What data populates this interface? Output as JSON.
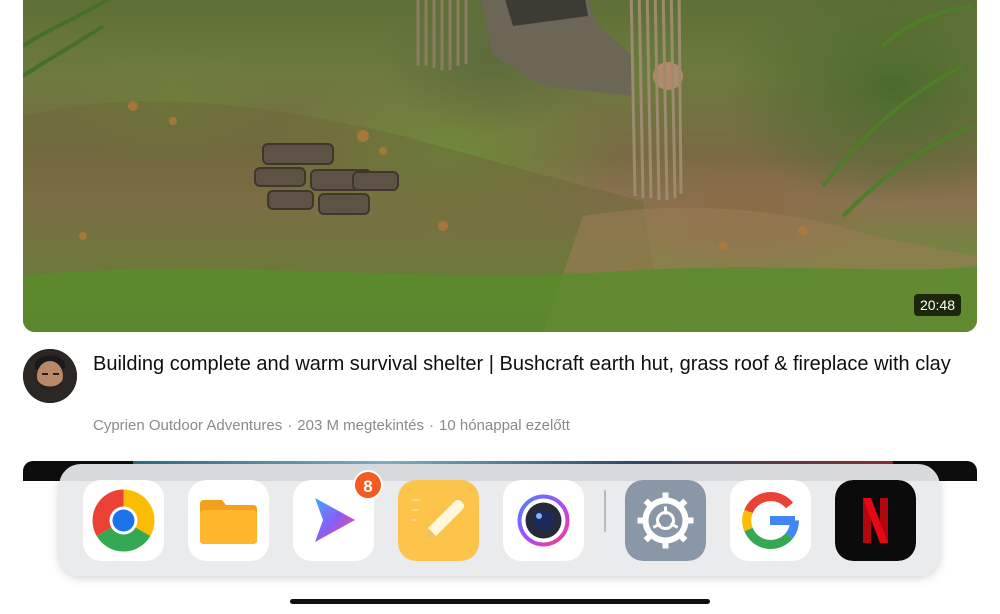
{
  "video": {
    "duration": "20:48",
    "title": "Building complete and warm survival shelter | Bushcraft earth hut, grass roof & fireplace with clay",
    "channel": "Cyprien Outdoor Adventures",
    "views": "203 M megtekintés",
    "age": "10 hónappal ezelőtt",
    "separator": "·"
  },
  "dock": {
    "apps": [
      {
        "name": "Chrome",
        "icon": "chrome-icon"
      },
      {
        "name": "Files",
        "icon": "folder-icon"
      },
      {
        "name": "Video Player",
        "icon": "play-icon",
        "badge": "8"
      },
      {
        "name": "Notes",
        "icon": "pencil-icon"
      },
      {
        "name": "Camera",
        "icon": "camera-icon"
      },
      {
        "name": "Settings",
        "icon": "gear-icon"
      },
      {
        "name": "Google",
        "icon": "google-icon"
      },
      {
        "name": "Netflix",
        "icon": "netflix-icon"
      }
    ]
  },
  "colors": {
    "badge": "#f45a22",
    "netflix_red": "#e50914",
    "notes_yellow": "#fcc44a"
  }
}
